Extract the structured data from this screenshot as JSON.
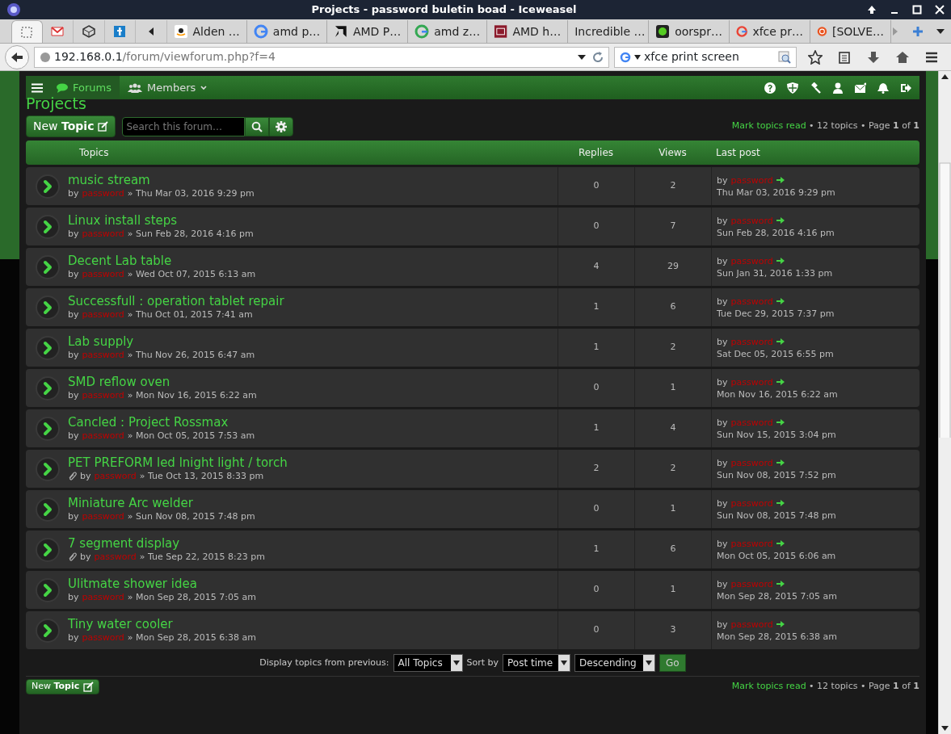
{
  "window": {
    "title": "Projects - password buletin boad - Iceweasel"
  },
  "browser": {
    "pinned_tabs": [
      {
        "selected": true
      },
      {
        "selected": false
      },
      {
        "selected": false
      },
      {
        "selected": false
      }
    ],
    "tabs": [
      {
        "label": "Alden …",
        "selected": false
      },
      {
        "label": "amd p…",
        "selected": false
      },
      {
        "label": "AMD P…",
        "selected": false
      },
      {
        "label": "amd z…",
        "selected": false
      },
      {
        "label": "AMD h…",
        "selected": false
      },
      {
        "label": "Incredible …",
        "selected": false
      },
      {
        "label": "oorspr…",
        "selected": false
      },
      {
        "label": "xfce pr…",
        "selected": false
      },
      {
        "label": "[SOLVE…",
        "selected": false
      }
    ],
    "address": {
      "host": "192.168.0.1",
      "path": "/forum/viewforum.php?f=4"
    },
    "search": {
      "value": "xfce print screen"
    }
  },
  "forum": {
    "nav": [
      {
        "label": "Forums",
        "selected": true,
        "kind": "forums"
      },
      {
        "label": "Members",
        "selected": false,
        "kind": "members"
      }
    ],
    "heading": "Projects",
    "new_topic": "New **Topic**",
    "search_placeholder": "Search this forum…",
    "pagination": {
      "link": "Mark topics read",
      "count": "• 12 topics •",
      "page": "Page **1** of **1**"
    },
    "columns": [
      "Topics",
      "Replies",
      "Views",
      "Last post"
    ],
    "topics": [
      {
        "title": "music stream",
        "by": "by",
        "author": "password",
        "date": "» Thu Mar 03, 2016 9:29 pm",
        "attachment": false,
        "replies": "0",
        "views": "2",
        "last_by": "by",
        "last_author": "password",
        "last_date": "Thu Mar 03, 2016 9:29 pm"
      },
      {
        "title": "Linux install steps",
        "by": "by",
        "author": "password",
        "date": "» Sun Feb 28, 2016 4:16 pm",
        "attachment": false,
        "replies": "0",
        "views": "7",
        "last_by": "by",
        "last_author": "password",
        "last_date": "Sun Feb 28, 2016 4:16 pm"
      },
      {
        "title": "Decent Lab table",
        "by": "by",
        "author": "password",
        "date": "» Wed Oct 07, 2015 6:13 am",
        "attachment": false,
        "replies": "4",
        "views": "29",
        "last_by": "by",
        "last_author": "password",
        "last_date": "Sun Jan 31, 2016 1:33 pm"
      },
      {
        "title": "Successfull : operation tablet repair",
        "by": "by",
        "author": "password",
        "date": "» Thu Oct 01, 2015 7:41 am",
        "attachment": false,
        "replies": "1",
        "views": "6",
        "last_by": "by",
        "last_author": "password",
        "last_date": "Tue Dec 29, 2015 7:37 pm"
      },
      {
        "title": "Lab supply",
        "by": "by",
        "author": "password",
        "date": "» Thu Nov 26, 2015 6:47 am",
        "attachment": false,
        "replies": "1",
        "views": "2",
        "last_by": "by",
        "last_author": "password",
        "last_date": "Sat Dec 05, 2015 6:55 pm"
      },
      {
        "title": "SMD reflow oven",
        "by": "by",
        "author": "password",
        "date": "» Mon Nov 16, 2015 6:22 am",
        "attachment": false,
        "replies": "0",
        "views": "1",
        "last_by": "by",
        "last_author": "password",
        "last_date": "Mon Nov 16, 2015 6:22 am"
      },
      {
        "title": "Cancled : Project Rossmax",
        "by": "by",
        "author": "password",
        "date": "» Mon Oct 05, 2015 7:53 am",
        "attachment": false,
        "replies": "1",
        "views": "4",
        "last_by": "by",
        "last_author": "password",
        "last_date": "Sun Nov 15, 2015 3:04 pm"
      },
      {
        "title": "PET PREFORM led lnight light / torch",
        "by": "by",
        "author": "password",
        "date": "» Tue Oct 13, 2015 8:33 pm",
        "attachment": true,
        "replies": "2",
        "views": "2",
        "last_by": "by",
        "last_author": "password",
        "last_date": "Sun Nov 08, 2015 7:52 pm"
      },
      {
        "title": "Miniature Arc welder",
        "by": "by",
        "author": "password",
        "date": "» Sun Nov 08, 2015 7:48 pm",
        "attachment": false,
        "replies": "0",
        "views": "1",
        "last_by": "by",
        "last_author": "password",
        "last_date": "Sun Nov 08, 2015 7:48 pm"
      },
      {
        "title": "7 segment display",
        "by": "by",
        "author": "password",
        "date": "» Tue Sep 22, 2015 8:23 pm",
        "attachment": true,
        "replies": "1",
        "views": "6",
        "last_by": "by",
        "last_author": "password",
        "last_date": "Mon Oct 05, 2015 6:06 am"
      },
      {
        "title": "Ulitmate shower idea",
        "by": "by",
        "author": "password",
        "date": "» Mon Sep 28, 2015 7:05 am",
        "attachment": false,
        "replies": "0",
        "views": "1",
        "last_by": "by",
        "last_author": "password",
        "last_date": "Mon Sep 28, 2015 7:05 am"
      },
      {
        "title": "Tiny water cooler",
        "by": "by",
        "author": "password",
        "date": "» Mon Sep 28, 2015 6:38 am",
        "attachment": false,
        "replies": "0",
        "views": "3",
        "last_by": "by",
        "last_author": "password",
        "last_date": "Mon Sep 28, 2015 6:38 am"
      }
    ],
    "footer": {
      "display_label": "Display topics from previous:",
      "display_value": "All Topics",
      "sort_label": "Sort by",
      "sort_value": "Post time",
      "order_value": "Descending",
      "go": "Go"
    },
    "bottom": {
      "new_topic": "New **Topic**",
      "pagination": {
        "link": "Mark topics read",
        "count": "• 12 topics •",
        "page": "Page **1** of **1**"
      }
    }
  }
}
